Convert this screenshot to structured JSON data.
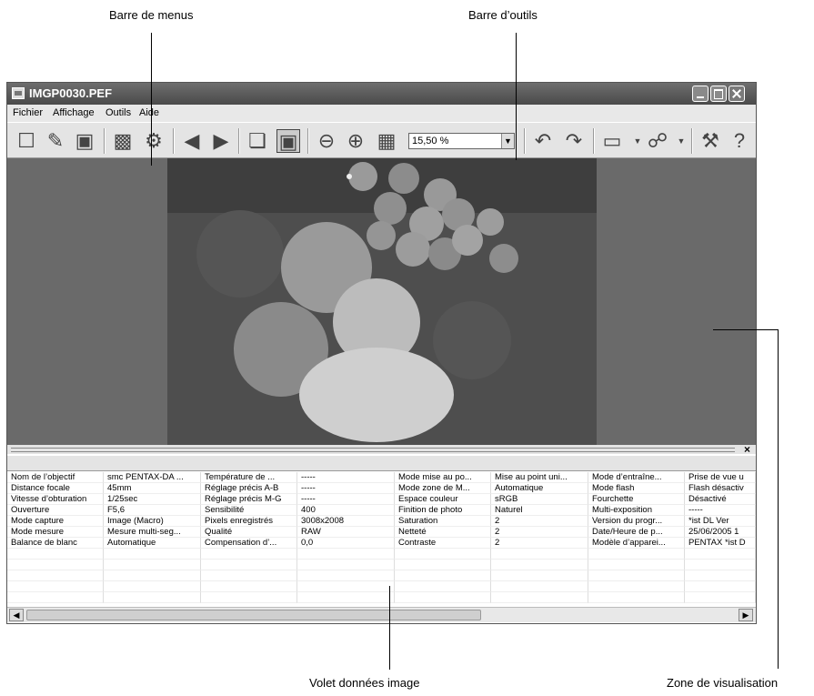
{
  "callouts": {
    "menubar": "Barre de menus",
    "toolbar": "Barre d’outils",
    "datapane": "Volet données image",
    "viewer": "Zone de visualisation"
  },
  "window": {
    "title": "IMGP0030.PEF"
  },
  "menu": [
    "Fichier",
    "Affichage",
    "Outils",
    "Aide"
  ],
  "toolbar": {
    "zoom_value": "15,50 %",
    "buttons": [
      "new-window",
      "open-folder",
      "save",
      "print",
      "settings",
      "previous",
      "next",
      "browse",
      "fit-window",
      "zoom-out",
      "zoom-in",
      "actual-size",
      "rotate-left",
      "rotate-right",
      "display-mode",
      "color",
      "tools",
      "help"
    ]
  },
  "data_table": {
    "rows": [
      [
        "Nom de l’objectif",
        "smc PENTAX-DA ...",
        "Température de ...",
        "-----",
        "Mode mise au po...",
        "Mise au point uni...",
        "Mode d’entraîne...",
        "Prise de vue u"
      ],
      [
        "Distance focale",
        "45mm",
        "Réglage précis A-B",
        "-----",
        "Mode zone de M...",
        "Automatique",
        "Mode flash",
        "Flash désactiv"
      ],
      [
        "Vitesse d’obturation",
        "1/25sec",
        "Réglage précis M-G",
        "-----",
        "Espace couleur",
        "sRGB",
        "Fourchette",
        "Désactivé"
      ],
      [
        "Ouverture",
        "F5,6",
        "Sensibilité",
        "400",
        "Finition de photo",
        "Naturel",
        "Multi-exposition",
        "-----"
      ],
      [
        "Mode capture",
        "Image (Macro)",
        "Pixels enregistrés",
        "3008x2008",
        "Saturation",
        "2",
        "Version du progr...",
        "*ist DL    Ver"
      ],
      [
        "Mode mesure",
        "Mesure multi-seg...",
        "Qualité",
        "RAW",
        "Netteté",
        "2",
        "Date/Heure de p...",
        "25/06/2005 1"
      ],
      [
        "Balance de blanc",
        "Automatique",
        "Compensation d’...",
        "0,0",
        "Contraste",
        "2",
        "Modèle d’apparei...",
        "PENTAX *ist D"
      ]
    ]
  }
}
